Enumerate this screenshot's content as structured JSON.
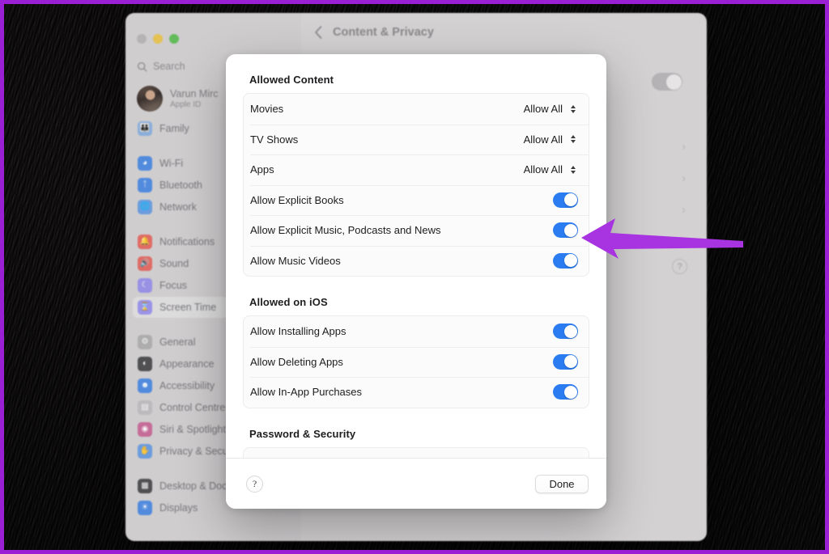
{
  "annotation": {
    "frame_color": "#9b1fd4",
    "arrow_color": "#a833e0",
    "arrow_target": "allow-explicit-music-toggle"
  },
  "background_window": {
    "traffic_lights": [
      "close",
      "minimize",
      "zoom"
    ],
    "search": {
      "placeholder": "Search",
      "icon": "search-icon"
    },
    "account": {
      "name": "Varun Mirc",
      "subtitle": "Apple ID",
      "avatar": "user-avatar"
    },
    "sidebar": {
      "groups": [
        {
          "items": [
            {
              "label": "Family",
              "icon": "family-icon",
              "color": "#7fa8dd"
            }
          ]
        },
        {
          "items": [
            {
              "label": "Wi-Fi",
              "icon": "wifi-icon",
              "color": "#3d7fe0"
            },
            {
              "label": "Bluetooth",
              "icon": "bluetooth-icon",
              "color": "#3d7fe0"
            },
            {
              "label": "Network",
              "icon": "network-icon",
              "color": "#5b93e0"
            }
          ]
        },
        {
          "items": [
            {
              "label": "Notifications",
              "icon": "notifications-icon",
              "color": "#e25b53"
            },
            {
              "label": "Sound",
              "icon": "sound-icon",
              "color": "#e25b53"
            },
            {
              "label": "Focus",
              "icon": "focus-icon",
              "color": "#8f86e8"
            },
            {
              "label": "Screen Time",
              "icon": "screen-time-icon",
              "color": "#8f86e8",
              "selected": true
            }
          ]
        },
        {
          "items": [
            {
              "label": "General",
              "icon": "general-icon",
              "color": "#a9a7a9"
            },
            {
              "label": "Appearance",
              "icon": "appearance-icon",
              "color": "#3a3a3c"
            },
            {
              "label": "Accessibility",
              "icon": "accessibility-icon",
              "color": "#3d7fe0"
            },
            {
              "label": "Control Centre",
              "icon": "control-centre-icon",
              "color": "#b9b7b9"
            },
            {
              "label": "Siri & Spotlight",
              "icon": "siri-icon",
              "color": "#c35b8f"
            },
            {
              "label": "Privacy & Security",
              "icon": "privacy-icon",
              "color": "#5b93e0"
            }
          ]
        },
        {
          "items": [
            {
              "label": "Desktop & Dock",
              "icon": "desktop-dock-icon",
              "color": "#3a3a3c"
            },
            {
              "label": "Displays",
              "icon": "displays-icon",
              "color": "#3d7fe0"
            }
          ]
        }
      ]
    },
    "detail": {
      "back_icon": "chevron-left-icon",
      "title": "Content & Privacy",
      "master_toggle": "off",
      "disclosure_rows": 4,
      "disclosure_icon": "chevron-right-icon",
      "help_label": "?"
    }
  },
  "sheet": {
    "sections": [
      {
        "title": "Allowed Content",
        "rows": [
          {
            "label": "Movies",
            "control": "popup",
            "value": "Allow All"
          },
          {
            "label": "TV Shows",
            "control": "popup",
            "value": "Allow All"
          },
          {
            "label": "Apps",
            "control": "popup",
            "value": "Allow All"
          },
          {
            "label": "Allow Explicit Books",
            "control": "switch",
            "value": "on"
          },
          {
            "label": "Allow Explicit Music, Podcasts and News",
            "control": "switch",
            "value": "on"
          },
          {
            "label": "Allow Music Videos",
            "control": "switch",
            "value": "on"
          }
        ]
      },
      {
        "title": "Allowed on iOS",
        "rows": [
          {
            "label": "Allow Installing Apps",
            "control": "switch",
            "value": "on"
          },
          {
            "label": "Allow Deleting Apps",
            "control": "switch",
            "value": "on"
          },
          {
            "label": "Allow In-App Purchases",
            "control": "switch",
            "value": "on"
          }
        ]
      },
      {
        "title": "Password & Security",
        "rows": []
      }
    ],
    "footer": {
      "help_label": "?",
      "done_label": "Done"
    },
    "colors": {
      "switch_on": "#2b7cf1",
      "switch_off": "#c9c8ca"
    }
  }
}
